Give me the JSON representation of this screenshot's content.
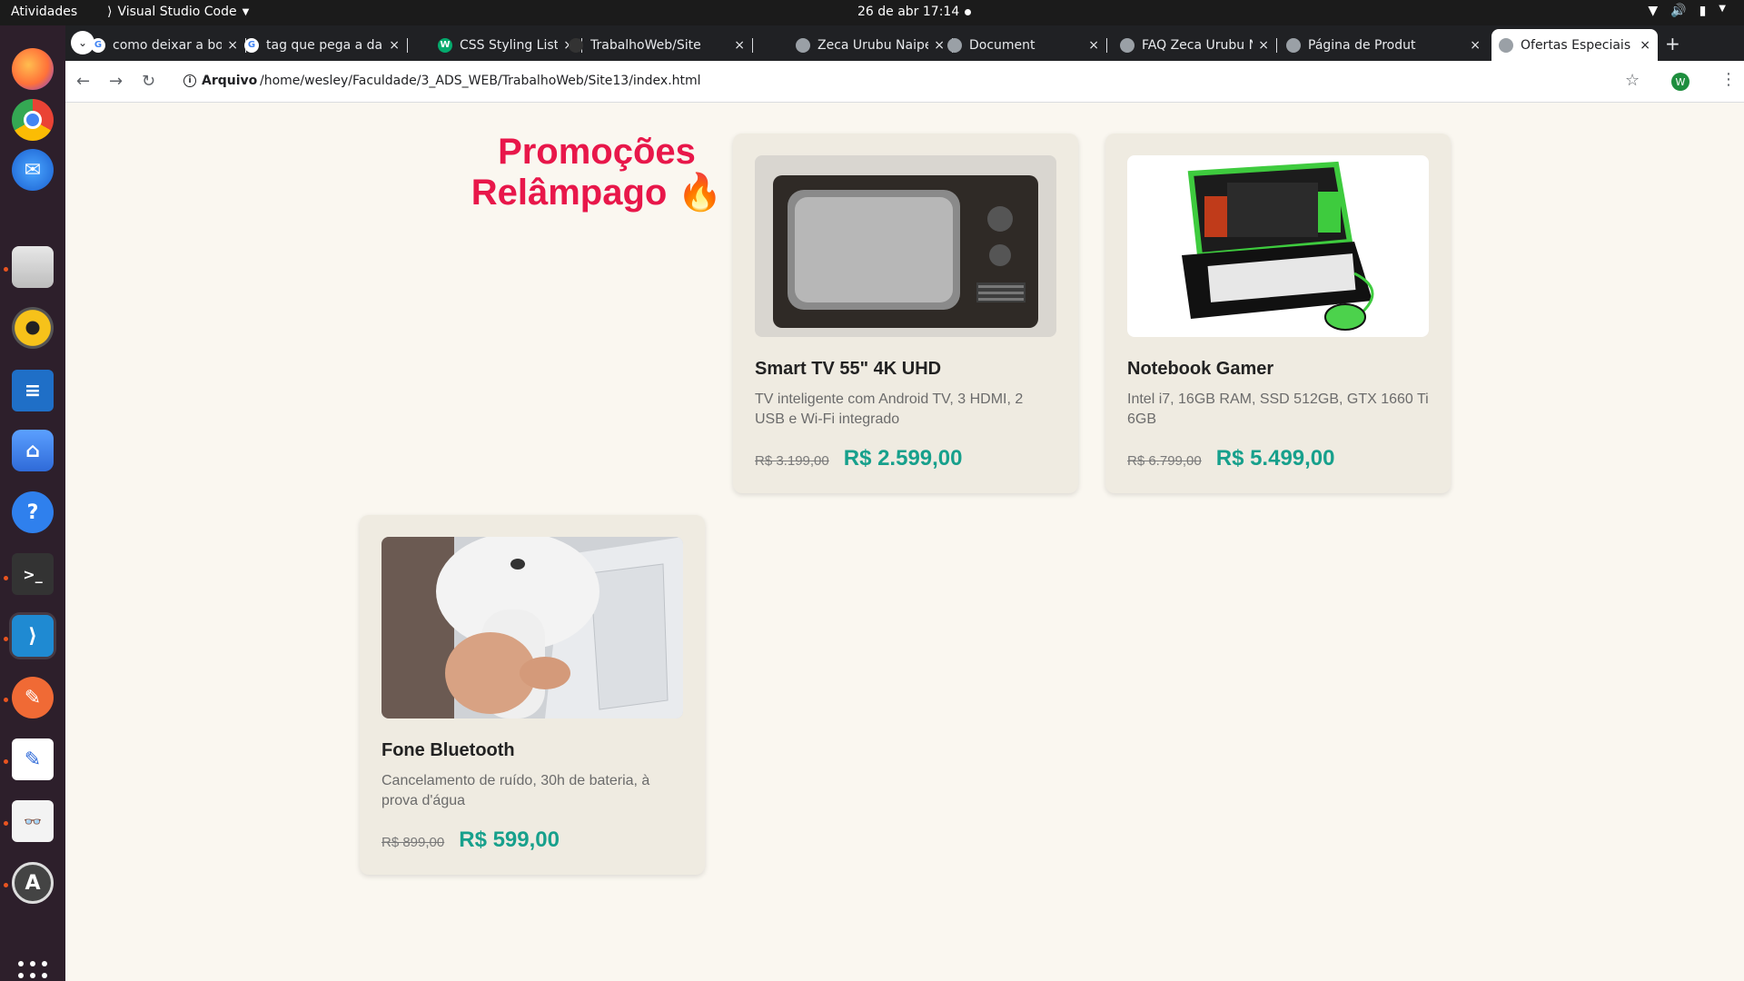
{
  "topbar": {
    "activities": "Atividades",
    "app_name": "Visual Studio Code",
    "clock": "26 de abr  17:14"
  },
  "dock": {
    "items": [
      "firefox-icon",
      "chrome-icon",
      "thunderbird-icon",
      "files-icon",
      "rhythmbox-icon",
      "writer-icon",
      "software-icon",
      "help-icon",
      "terminal-icon",
      "vscode-icon",
      "draw-icon",
      "text-editor-icon",
      "reader-icon",
      "updater-icon"
    ]
  },
  "browser": {
    "tabs": [
      {
        "title": "como deixar a bor",
        "favicon": "google-icon"
      },
      {
        "title": "tag que pega a da",
        "favicon": "google-icon"
      },
      {
        "title": "CSS Styling Lists",
        "favicon": "w3schools-icon"
      },
      {
        "title": "TrabalhoWeb/Site",
        "favicon": "github-icon"
      },
      {
        "title": "Zeca Urubu Naipe",
        "favicon": "globe-icon"
      },
      {
        "title": "Document",
        "favicon": "globe-icon"
      },
      {
        "title": "FAQ Zeca Urubu N",
        "favicon": "globe-icon"
      },
      {
        "title": "Página de Produt",
        "favicon": "globe-icon"
      },
      {
        "title": "Ofertas Especiais",
        "favicon": "globe-icon",
        "active": true
      }
    ],
    "security_label": "Arquivo",
    "url": "/home/wesley/Faculdade/3_ADS_WEB/TrabalhoWeb/Site13/index.html",
    "profile_initial": "W"
  },
  "page": {
    "heading_line1": "Promoções",
    "heading_line2": "Relâmpago 🔥",
    "products": [
      {
        "name": "Smart TV 55\" 4K UHD",
        "description": "TV inteligente com Android TV, 3 HDMI, 2 USB e Wi-Fi integrado",
        "old_price": "R$ 3.199,00",
        "new_price": "R$ 2.599,00",
        "image": "retro-tv-image"
      },
      {
        "name": "Notebook Gamer",
        "description": "Intel i7, 16GB RAM, SSD 512GB, GTX 1660 Ti 6GB",
        "old_price": "R$ 6.799,00",
        "new_price": "R$ 5.499,00",
        "image": "toy-laptop-image"
      },
      {
        "name": "Fone Bluetooth",
        "description": "Cancelamento de ruído, 30h de bateria, à prova d'água",
        "old_price": "R$ 899,00",
        "new_price": "R$ 599,00",
        "image": "earbud-image"
      }
    ]
  },
  "colors": {
    "heading": "#e8174a",
    "price": "#17a08c",
    "card": "#efebe1",
    "background": "#faf7f0"
  }
}
